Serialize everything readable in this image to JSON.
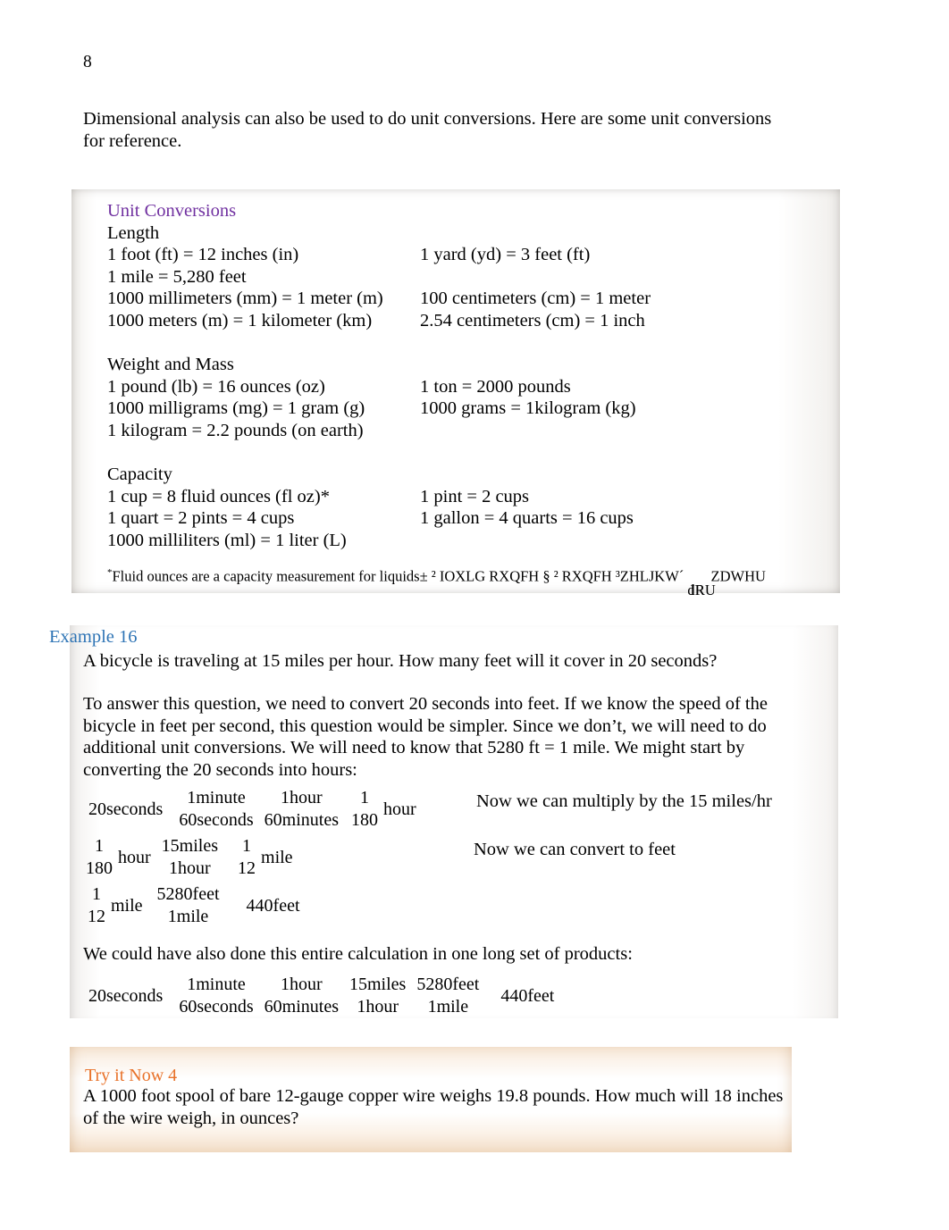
{
  "page": {
    "number": "8"
  },
  "intro": {
    "text": "Dimensional analysis can also be used to do unit conversions.  Here are some unit conversions for reference."
  },
  "unit_conversions": {
    "title": "Unit Conversions",
    "title_color": "#7030A0",
    "sections": [
      {
        "heading": "Length",
        "rows": [
          {
            "left": "1 foot (ft) = 12 inches (in)",
            "right": "1 yard (yd) = 3 feet (ft)"
          },
          {
            "left": "1 mile = 5,280 feet",
            "right": ""
          },
          {
            "left": "1000 millimeters (mm) = 1 meter (m)",
            "right": "100 centimeters (cm) = 1 meter"
          },
          {
            "left": "1000 meters (m) = 1 kilometer (km)",
            "right": "2.54 centimeters (cm) = 1 inch"
          }
        ]
      },
      {
        "heading": "Weight and Mass",
        "rows": [
          {
            "left": "1 pound (lb) = 16 ounces (oz)",
            "right": "1 ton = 2000 pounds"
          },
          {
            "left": "1000 milligrams (mg) = 1 gram (g)",
            "right": "1000 grams = 1kilogram (kg)"
          },
          {
            "left": "1 kilogram = 2.2 pounds (on earth)",
            "right": ""
          }
        ]
      },
      {
        "heading": "Capacity",
        "rows": [
          {
            "left": "1 cup = 8 fluid ounces (fl oz)*",
            "right": "1 pint = 2 cups"
          },
          {
            "left": "1 quart = 2 pints = 4 cups",
            "right": "1 gallon = 4 quarts = 16 cups"
          },
          {
            "left": "1000 milliliters (ml) = 1 liter (L)",
            "right": ""
          }
        ]
      }
    ],
    "footnote": {
      "marker": "*",
      "readable": "Fluid ounces are a capacity measurement for liquids",
      "garbled_1": "± ² IOXLG RXQFH § ² RXQFH ³ZHLJKW´ ",
      "garbled_overlap_a": "dR",
      "garbled_overlap_b": "IRU",
      "garbled_2": " ZDWHU"
    }
  },
  "example": {
    "heading": "Example 16",
    "heading_color": "#2E74B5",
    "question": "A bicycle is traveling at 15 miles per hour.  How many feet will it cover in 20 seconds?",
    "body": "To answer this question, we need to convert 20 seconds into feet.   If we know the speed of the bicycle in feet per second, this question would be simpler.  Since we don’t, we will need to do additional unit conversions.  We will need to know that 5280 ft = 1 mile.  We might start by converting the 20 seconds into hours:",
    "body2": "We could have also done this entire calculation in one long set of products:",
    "math": {
      "line1": {
        "lead": "20seconds",
        "fractions": [
          {
            "num": "1minute",
            "den": "60seconds"
          },
          {
            "num": "1hour",
            "den": "60minutes"
          },
          {
            "num": "1",
            "den": "180"
          }
        ],
        "result_unit": "hour"
      },
      "note1": "Now we can multiply by the 15 miles/hr",
      "line2": {
        "fractions": [
          {
            "num": "1",
            "den": "180",
            "unit": "hour"
          },
          {
            "num": "15miles",
            "den": "1hour",
            "unit": ""
          },
          {
            "num": "1",
            "den": "12",
            "unit": "mile"
          }
        ]
      },
      "note2": "Now we can convert to feet",
      "line3": {
        "fractions": [
          {
            "num": "1",
            "den": "12",
            "unit": "mile"
          },
          {
            "num": "5280feet",
            "den": "1mile",
            "unit": ""
          }
        ],
        "result": "440feet"
      },
      "line4": {
        "lead": "20seconds",
        "fractions": [
          {
            "num": "1minute",
            "den": "60seconds"
          },
          {
            "num": "1hour",
            "den": "60minutes"
          },
          {
            "num": "15miles",
            "den": "1hour"
          },
          {
            "num": "5280feet",
            "den": "1mile"
          }
        ],
        "result": "440feet"
      }
    }
  },
  "try_it_now": {
    "heading": "Try it Now 4",
    "heading_color": "#E8722A",
    "body": "A 1000 foot spool of bare 12-gauge copper wire weighs 19.8 pounds.  How much will 18 inches of the wire weigh, in ounces?"
  }
}
